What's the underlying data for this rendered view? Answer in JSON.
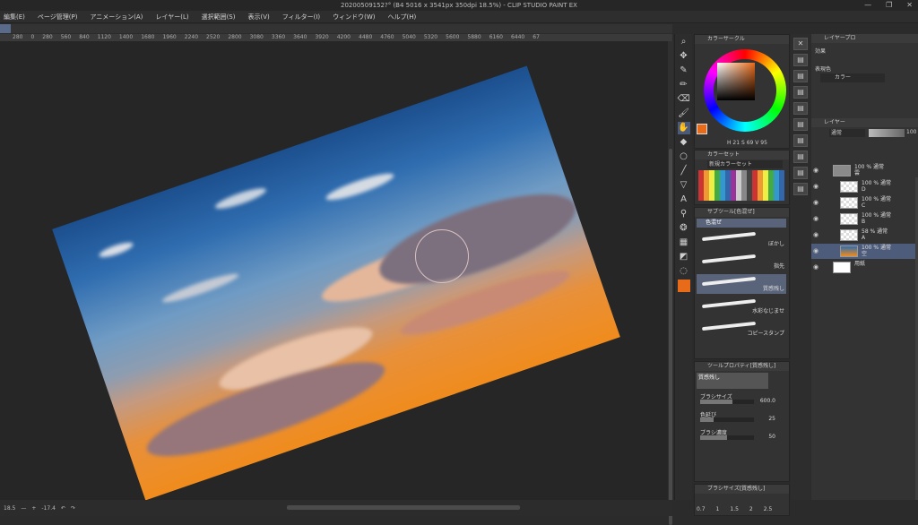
{
  "window": {
    "title": "20200509152?° (B4 5016 x 3541px 350dpi 18.5%) - CLIP STUDIO PAINT EX",
    "controls": [
      "—",
      "❐",
      "✕"
    ]
  },
  "menu": [
    "編集(E)",
    "ページ管理(P)",
    "アニメーション(A)",
    "レイヤー(L)",
    "選択範囲(S)",
    "表示(V)",
    "フィルター(I)",
    "ウィンドウ(W)",
    "ヘルプ(H)"
  ],
  "ruler_ticks": [
    "280",
    "0",
    "280",
    "560",
    "840",
    "1120",
    "1400",
    "1680",
    "1960",
    "2240",
    "2520",
    "2800",
    "3080",
    "3360",
    "3640",
    "3920",
    "4200",
    "4480",
    "4760",
    "5040",
    "5320",
    "5600",
    "5880",
    "6160",
    "6440",
    "67"
  ],
  "status": {
    "zoom": "18.5",
    "angle": "-17.4",
    "zoom_minus": "—",
    "zoom_plus": "+"
  },
  "color_circle": {
    "title": "カラーサークル",
    "main_color": "#e86b1a",
    "h": "H 21",
    "s": "S 69",
    "v": "V 95"
  },
  "color_set": {
    "title": "カラーセット",
    "selected_set": "新規カラーセット"
  },
  "subtool": {
    "title": "サブツール[色混ぜ]",
    "group": "色混ぜ",
    "brushes": [
      {
        "name": "ぼかし"
      },
      {
        "name": "指先"
      },
      {
        "name": "質感残し"
      },
      {
        "name": "水彩なじませ"
      },
      {
        "name": "コピースタンプ"
      }
    ]
  },
  "tool_property": {
    "title": "ツールプロパティ[質感残し]",
    "brush_name": "質感残し",
    "props": [
      {
        "label": "ブラシサイズ",
        "value": "600.0",
        "fill": 0.6
      },
      {
        "label": "色延び",
        "value": "25",
        "fill": 0.25
      },
      {
        "label": "ブラシ濃度",
        "value": "50",
        "fill": 0.5
      }
    ]
  },
  "brush_size": {
    "title": "ブラシサイズ[質感残し]",
    "values": [
      "0.7",
      "1",
      "1.5",
      "2",
      "2.5"
    ]
  },
  "layer_property": {
    "title": "レイヤープロ",
    "effect_label": "効果",
    "expression_label": "表現色",
    "expression_value": "カラー"
  },
  "layers_panel": {
    "title": "レイヤー",
    "blend_mode": "通常",
    "opacity": "100",
    "layers": [
      {
        "name": "100 % 通常",
        "sub": "雲",
        "type": "folder"
      },
      {
        "name": "100 % 通常",
        "sub": "D",
        "type": "layer"
      },
      {
        "name": "100 % 通常",
        "sub": "C",
        "type": "layer"
      },
      {
        "name": "100 % 通常",
        "sub": "B",
        "type": "layer"
      },
      {
        "name": "58 % 通常",
        "sub": "A",
        "type": "layer"
      },
      {
        "name": "100 % 通常",
        "sub": "空",
        "type": "layer",
        "selected": true
      },
      {
        "name": "",
        "sub": "用紙",
        "type": "paper"
      }
    ]
  }
}
